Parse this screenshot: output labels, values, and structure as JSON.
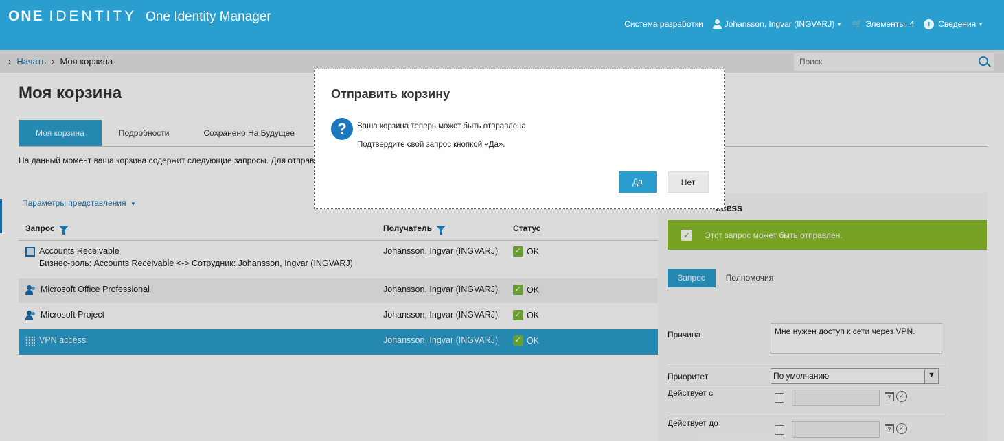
{
  "header": {
    "logo_one": "ONE",
    "logo_identity": "IDENTITY",
    "app_title": "One Identity Manager",
    "system": "Система разработки",
    "user": "Johansson, Ingvar (INGVARJ)",
    "cart": "Элементы: 4",
    "info": "Сведения",
    "colors": {
      "brand": "#2a9fcf",
      "accent": "#1c78bd",
      "ok": "#7ab838"
    }
  },
  "breadcrumb": {
    "home": "Начать",
    "current": "Моя корзина"
  },
  "search": {
    "placeholder": "Поиск"
  },
  "page": {
    "title": "Моя корзина",
    "tabs": [
      "Моя корзина",
      "Подробности",
      "Сохранено На Будущее"
    ],
    "description": "На данный момент ваша корзина содержит следующие запросы. Для отправк",
    "view_params": "Параметры представления"
  },
  "grid": {
    "headers": {
      "request": "Запрос",
      "recipient": "Получатель",
      "status": "Статус"
    },
    "rows": [
      {
        "name": "Accounts Receivable",
        "sub": "Бизнес-роль: Accounts Receivable <-> Сотрудник: Johansson, Ingvar (INGVARJ)",
        "recipient": "Johansson, Ingvar (INGVARJ)",
        "status": "OK",
        "icon": "business-role-icon"
      },
      {
        "name": "Microsoft Office Professional",
        "recipient": "Johansson, Ingvar (INGVARJ)",
        "status": "OK",
        "icon": "software-group-icon"
      },
      {
        "name": "Microsoft Project",
        "recipient": "Johansson, Ingvar (INGVARJ)",
        "status": "OK",
        "icon": "software-group-icon"
      },
      {
        "name": "VPN access",
        "recipient": "Johansson, Ingvar (INGVARJ)",
        "status": "OK",
        "icon": "system-entitlement-icon"
      }
    ]
  },
  "detail": {
    "title_tail": "ccess",
    "banner": "Этот запрос может быть отправлен.",
    "tabs": [
      "Запрос",
      "Полномочия"
    ],
    "reason_label": "Причина",
    "reason_value": "Мне нужен доступ к сети через VPN.",
    "priority_label": "Приоритет",
    "priority_value": "По умолчанию",
    "valid_from_label": "Действует с",
    "valid_to_label": "Действует до"
  },
  "modal": {
    "title": "Отправить корзину",
    "line1": "Ваша корзина теперь может быть отправлена.",
    "line2": "Подтвердите свой запрос кнопкой «Да».",
    "yes": "Да",
    "no": "Нет"
  }
}
